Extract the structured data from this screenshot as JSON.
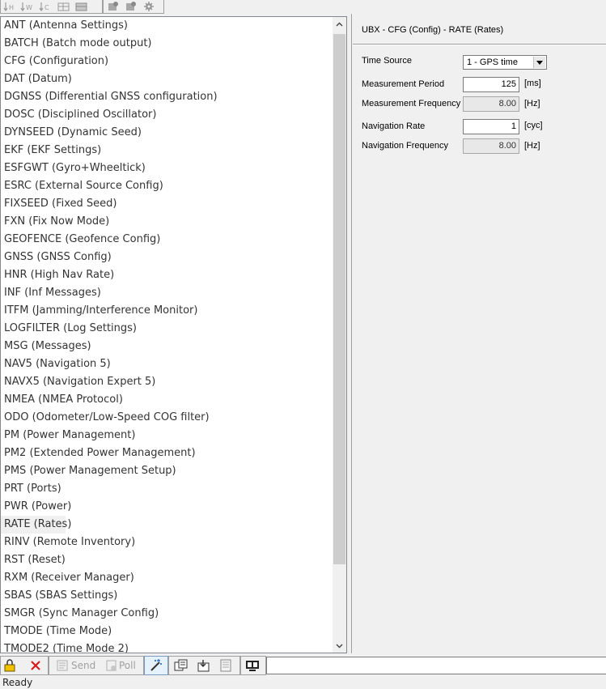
{
  "top_toolbar": {
    "buttons": [
      {
        "icon": "sort-hex-icon",
        "label": "H"
      },
      {
        "icon": "sort-word-icon",
        "label": "W"
      },
      {
        "icon": "sort-config-icon",
        "label": "C"
      },
      {
        "icon": "grid-icon",
        "label": ""
      },
      {
        "icon": "grid-save-icon",
        "label": ""
      },
      {
        "icon": "send-config-icon",
        "label": ""
      },
      {
        "icon": "receive-config-icon",
        "label": ""
      },
      {
        "icon": "gear-icon",
        "label": ""
      }
    ]
  },
  "message_list": {
    "selected_index": 28,
    "items": [
      "ANT (Antenna Settings)",
      "BATCH (Batch mode output)",
      "CFG (Configuration)",
      "DAT (Datum)",
      "DGNSS (Differential GNSS configuration)",
      "DOSC (Disciplined Oscillator)",
      "DYNSEED (Dynamic Seed)",
      "EKF (EKF Settings)",
      "ESFGWT (Gyro+Wheeltick)",
      "ESRC (External Source Config)",
      "FIXSEED (Fixed Seed)",
      "FXN (Fix Now Mode)",
      "GEOFENCE (Geofence Config)",
      "GNSS (GNSS Config)",
      "HNR (High Nav Rate)",
      "INF (Inf Messages)",
      "ITFM (Jamming/Interference Monitor)",
      "LOGFILTER (Log Settings)",
      "MSG (Messages)",
      "NAV5 (Navigation 5)",
      "NAVX5 (Navigation Expert 5)",
      "NMEA (NMEA Protocol)",
      "ODO (Odometer/Low-Speed COG filter)",
      "PM (Power Management)",
      "PM2 (Extended Power Management)",
      "PMS (Power Management Setup)",
      "PRT (Ports)",
      "PWR (Power)",
      "RATE (Rates)",
      "RINV (Remote Inventory)",
      "RST (Reset)",
      "RXM (Receiver Manager)",
      "SBAS (SBAS Settings)",
      "SMGR (Sync Manager Config)",
      "TMODE (Time Mode)",
      "TMODE2 (Time Mode 2)"
    ]
  },
  "config_panel": {
    "title": "UBX - CFG (Config) - RATE (Rates)",
    "time_source": {
      "label": "Time Source",
      "value": "1 - GPS time"
    },
    "measurement_period": {
      "label": "Measurement Period",
      "value": "125",
      "unit": "[ms]"
    },
    "measurement_frequency": {
      "label": "Measurement Frequency",
      "value": "8.00",
      "unit": "[Hz]"
    },
    "navigation_rate": {
      "label": "Navigation Rate",
      "value": "1",
      "unit": "[cyc]"
    },
    "navigation_frequency": {
      "label": "Navigation Frequency",
      "value": "8.00",
      "unit": "[Hz]"
    }
  },
  "bottom_toolbar": {
    "send_label": "Send",
    "poll_label": "Poll"
  },
  "status": {
    "text": "Ready"
  }
}
